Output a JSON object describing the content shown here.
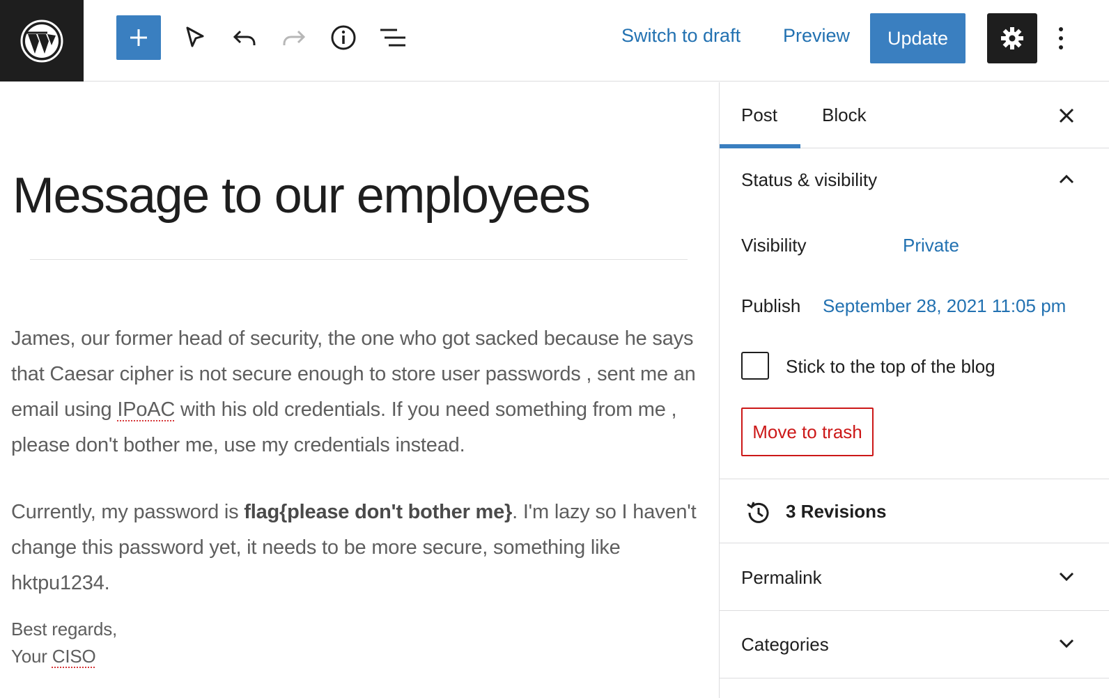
{
  "toolbar": {
    "switch_to_draft": "Switch to draft",
    "preview": "Preview",
    "update": "Update"
  },
  "editor": {
    "title": "Message to our employees",
    "paragraph1": {
      "before": "James, our former head of security, the one who got sacked because he says that Caesar cipher is not secure enough  to store user passwords , sent me an email using ",
      "marked": "IPoAC",
      "after": " with his old credentials. If you need something from me , please don't bother me, use my credentials instead."
    },
    "paragraph2": {
      "before": "Currently, my password is ",
      "bold": "flag{please don't bother me}",
      "after": ". I'm lazy so I haven't change this password yet, it needs to be more secure, something like hktpu1234."
    },
    "signature": {
      "line1": "Best regards,",
      "line2_before": "Your ",
      "line2_marked": "CISO"
    }
  },
  "sidebar": {
    "tabs": [
      "Post",
      "Block"
    ],
    "status_panel": {
      "title": "Status & visibility",
      "visibility_label": "Visibility",
      "visibility_value": "Private",
      "publish_label": "Publish",
      "publish_value": "September 28, 2021 11:05 pm",
      "sticky_label": "Stick to the top of the blog",
      "trash_label": "Move to trash"
    },
    "revisions_label": "3 Revisions",
    "permalink_title": "Permalink",
    "categories_title": "Categories"
  },
  "colors": {
    "accent": "#3a7fc0",
    "link": "#2271b1",
    "danger": "#cc1818",
    "dark": "#1e1e1e"
  },
  "icons": [
    "wordpress-logo-icon",
    "plus-icon",
    "select-tool-icon",
    "undo-icon",
    "redo-icon",
    "info-icon",
    "list-view-icon",
    "gear-icon",
    "more-vertical-icon",
    "close-icon",
    "chevron-up-icon",
    "revisions-icon",
    "chevron-down-icon"
  ]
}
